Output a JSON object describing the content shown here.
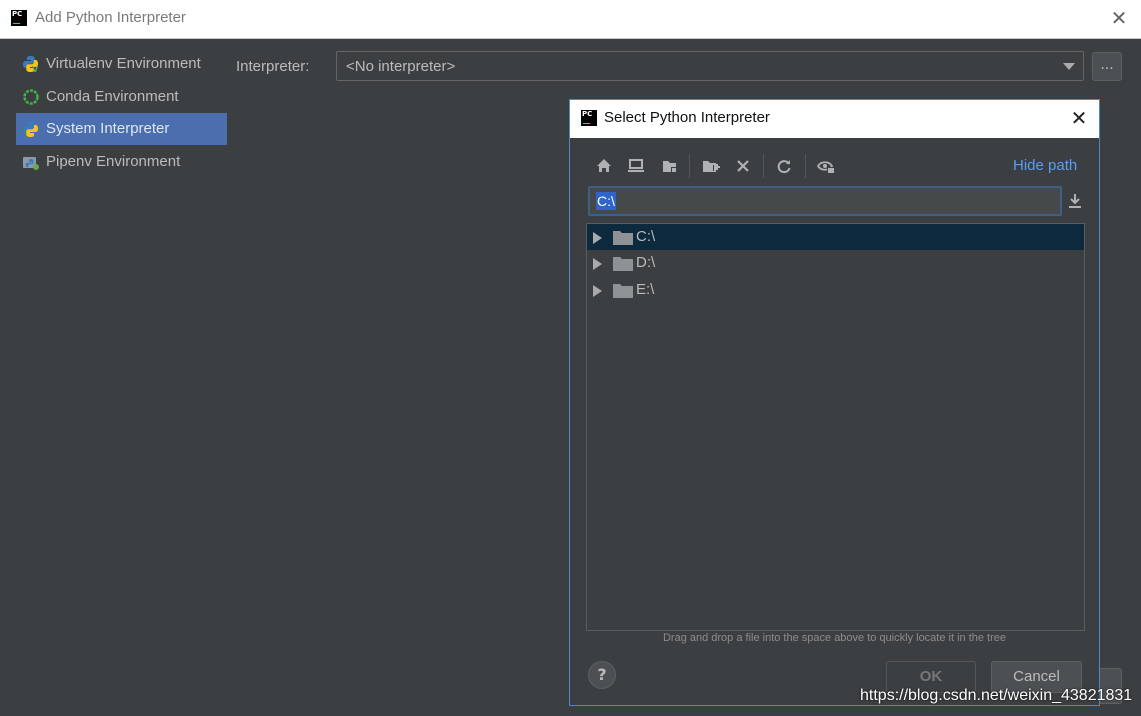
{
  "window": {
    "title": "Add Python Interpreter",
    "close_glyph": "✕",
    "logo_text": "PC"
  },
  "sidebar": {
    "items": [
      {
        "label": "Virtualenv Environment",
        "icon": "python-virtualenv-icon"
      },
      {
        "label": "Conda Environment",
        "icon": "conda-icon"
      },
      {
        "label": "System Interpreter",
        "icon": "python-icon",
        "selected": true
      },
      {
        "label": "Pipenv Environment",
        "icon": "pipenv-icon"
      }
    ]
  },
  "main": {
    "interpreter_label": "Interpreter:",
    "interpreter_value": "<No interpreter>",
    "browse_label": "..."
  },
  "dialog": {
    "title": "Select Python Interpreter",
    "close_glyph": "✕",
    "logo_text": "PC",
    "toolbar": {
      "icons": [
        "home-icon",
        "desktop-icon",
        "project-folder-icon",
        "new-folder-icon",
        "delete-icon",
        "refresh-icon",
        "show-hidden-icon"
      ],
      "hide_path_label": "Hide path"
    },
    "path_value": "C:\\",
    "tree": [
      {
        "label": "C:\\",
        "selected": true
      },
      {
        "label": "D:\\"
      },
      {
        "label": "E:\\"
      }
    ],
    "hint": "Drag and drop a file into the space above to quickly locate it in the tree",
    "help_label": "?",
    "ok_label": "OK",
    "cancel_label": "Cancel"
  },
  "watermark": "https://blog.csdn.net/weixin_43821831",
  "colors": {
    "accent": "#4b6eaf",
    "link": "#589df6",
    "dialog_border": "#4a88c7",
    "tree_selected": "#0d293e"
  }
}
